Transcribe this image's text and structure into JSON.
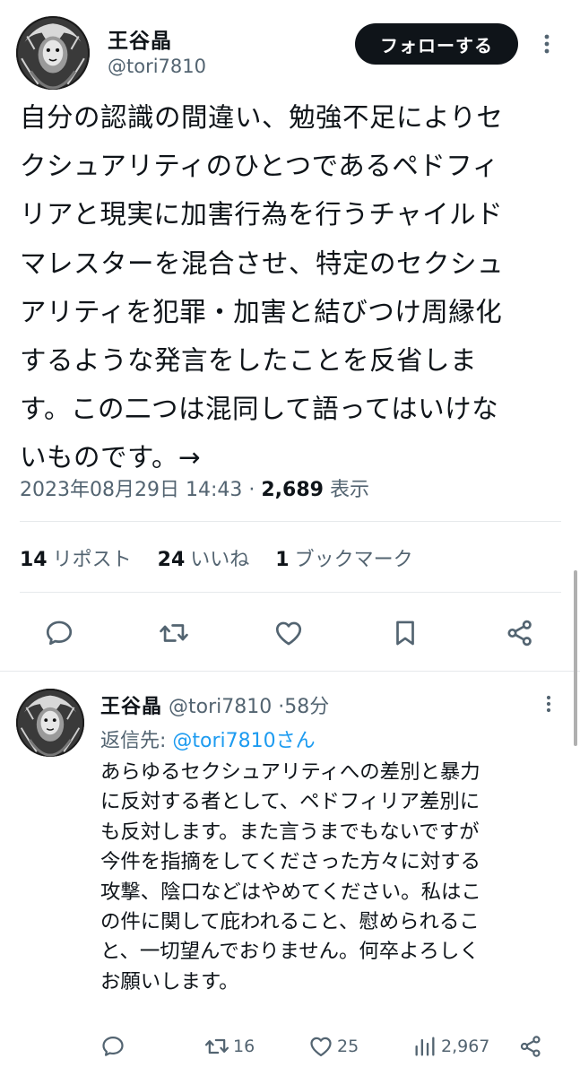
{
  "main_tweet": {
    "display_name": "王谷晶",
    "handle": "@tori7810",
    "follow_label": "フォローする",
    "text_lines": [
      "自分の認識の間違い、勉強不足によりセ",
      "クシュアリティのひとつであるペドフィ",
      "リアと現実に加害行為を行うチャイルド",
      "マレスターを混合させ、特定のセクシュ",
      "アリティを犯罪・加害と結びつけ周縁化",
      "するような発言をしたことを反省しま",
      "す。この二つは混同して語ってはいけな",
      "いものです。→"
    ],
    "timestamp": "2023年08月29日 14:43",
    "separator": "·",
    "views_count": "2,689",
    "views_label": "表示",
    "stats": {
      "reposts_count": "14",
      "reposts_label": "リポスト",
      "likes_count": "24",
      "likes_label": "いいね",
      "bookmarks_count": "1",
      "bookmarks_label": "ブックマーク"
    },
    "icons": [
      "reply-icon",
      "repost-icon",
      "like-icon",
      "bookmark-icon",
      "share-icon"
    ]
  },
  "reply_tweet": {
    "display_name": "王谷晶",
    "handle": "@tori7810",
    "separator": "·",
    "time_ago": "58分",
    "reply_prefix": "返信先: ",
    "reply_mention": "@tori7810さん",
    "text_lines": [
      "あらゆるセクシュアリティへの差別と暴力",
      "に反対する者として、ペドフィリア差別に",
      "も反対します。また言うまでもないですが",
      "今件を指摘をしてくださった方々に対する",
      "攻撃、陰口などはやめてください。私はこ",
      "の件に関して庇われること、慰められるこ",
      "と、一切望んでおりません。何卒よろしく",
      "お願いします。"
    ],
    "actions": {
      "reposts": "16",
      "likes": "25",
      "views": "2,967"
    }
  },
  "colors": {
    "text": "#0f1419",
    "secondary": "#536471",
    "link": "#1d9bf0",
    "divider": "#e6e9ec",
    "follow_bg": "#0f1419"
  }
}
